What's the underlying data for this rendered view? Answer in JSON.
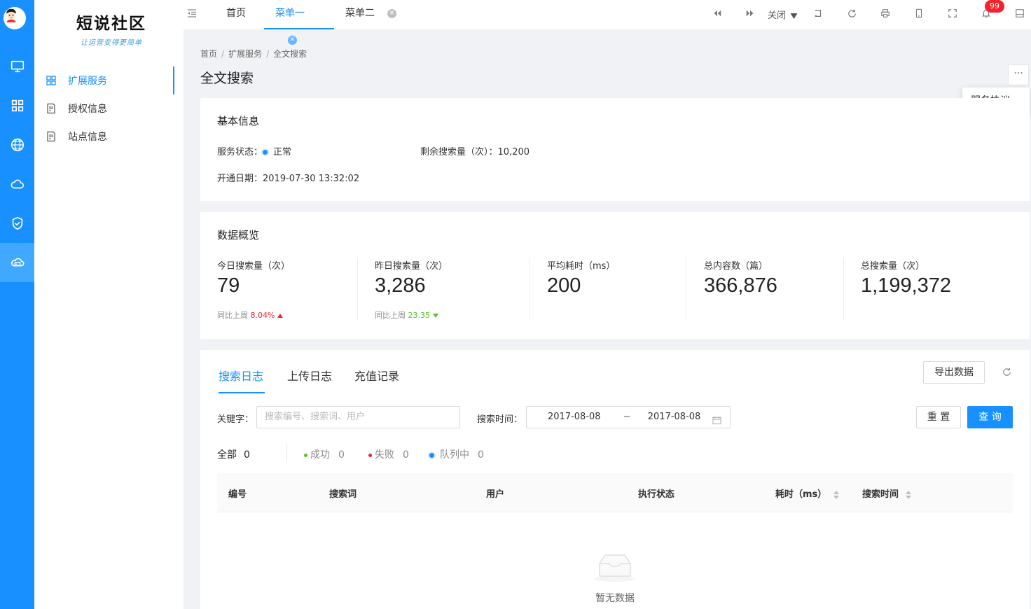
{
  "app": {
    "logo_title": "短说社区",
    "logo_subtitle": "让运营变得更简单"
  },
  "rail": {
    "items": [
      "monitor-icon",
      "apps-grid-icon",
      "globe-icon",
      "cloud-icon",
      "shield-check-icon",
      "cloud-server-icon"
    ],
    "active_index": 5
  },
  "sidebar": {
    "items": [
      {
        "label": "扩展服务",
        "active": true
      },
      {
        "label": "授权信息",
        "active": false
      },
      {
        "label": "站点信息",
        "active": false
      }
    ]
  },
  "topbar": {
    "tabs": [
      {
        "label": "首页",
        "closable": false,
        "active": false
      },
      {
        "label": "菜单一",
        "closable": true,
        "active": true
      },
      {
        "label": "菜单二",
        "closable": true,
        "active": false
      }
    ],
    "close_label": "关闭",
    "notification_count": "99"
  },
  "breadcrumb": [
    "首页",
    "扩展服务",
    "全文搜索"
  ],
  "page_title": "全文搜索",
  "more_button": "···",
  "dropdown": {
    "item": "服务协议"
  },
  "basic_info": {
    "title": "基本信息",
    "status_label": "服务状态：",
    "status_value": "正常",
    "remaining_label": "剩余搜索量（次）：",
    "remaining_value": "10,200",
    "open_date_label": "开通日期：",
    "open_date_value": "2019-07-30 13:32:02"
  },
  "overview": {
    "title": "数据概览",
    "stats": [
      {
        "label": "今日搜索量（次）",
        "value": "79",
        "compare_label": "同比上周",
        "compare_value": "8.04%",
        "trend": "up"
      },
      {
        "label": "昨日搜索量（次）",
        "value": "3,286",
        "compare_label": "同比上周",
        "compare_value": "23.35",
        "trend": "down"
      },
      {
        "label": "平均耗时（ms）",
        "value": "200"
      },
      {
        "label": "总内容数（篇）",
        "value": "366,876"
      },
      {
        "label": "总搜索量（次）",
        "value": "1,199,372"
      }
    ]
  },
  "logs": {
    "tabs": [
      "搜索日志",
      "上传日志",
      "充值记录"
    ],
    "active_tab": 0,
    "export_label": "导出数据",
    "keyword_label": "关键字：",
    "keyword_placeholder": "搜索编号、搜索词、用户",
    "time_label": "搜索时间：",
    "date_start": "2017-08-08",
    "date_sep": "~",
    "date_end": "2017-08-08",
    "reset_label": "重 置",
    "query_label": "查 询",
    "filters": {
      "all_label": "全部",
      "all_count": "0",
      "success_label": "成功",
      "success_count": "0",
      "fail_label": "失败",
      "fail_count": "0",
      "queue_label": "队列中",
      "queue_count": "0"
    },
    "columns": [
      "编号",
      "搜索词",
      "用户",
      "执行状态",
      "耗时（ms）",
      "搜索时间"
    ],
    "empty_text": "暂无数据"
  },
  "colors": {
    "primary": "#1890ff",
    "success": "#52c41a",
    "danger": "#f5222d",
    "up": "#f5222d",
    "down": "#52c41a"
  }
}
